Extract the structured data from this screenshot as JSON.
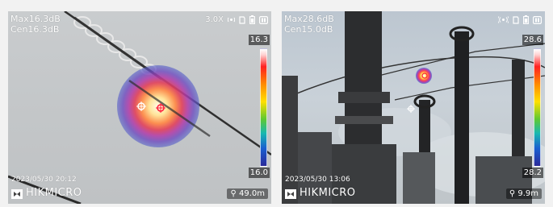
{
  "panels": [
    {
      "max_label": "Max16.3dB",
      "cen_label": "Cen16.3dB",
      "zoom": "3.0X",
      "scale_high": "16.3",
      "scale_low": "16.0",
      "timestamp": "2023/05/30 20:12",
      "brand": "HIKMICRO",
      "distance": "49.0m"
    },
    {
      "max_label": "Max28.6dB",
      "cen_label": "Cen15.0dB",
      "scale_high": "28.6",
      "scale_low": "28.2",
      "timestamp": "2023/05/30 13:06",
      "brand": "HIKMICRO",
      "distance": "9.9m"
    }
  ],
  "colors": {
    "sky_left": "#c6c9cb",
    "sky_right": "#c4ccd4",
    "text": "#ffffff"
  },
  "icons": [
    "signal-icon",
    "sd-card-icon",
    "battery-icon",
    "mode-icon",
    "location-pin-icon",
    "hikmicro-logo-icon"
  ]
}
